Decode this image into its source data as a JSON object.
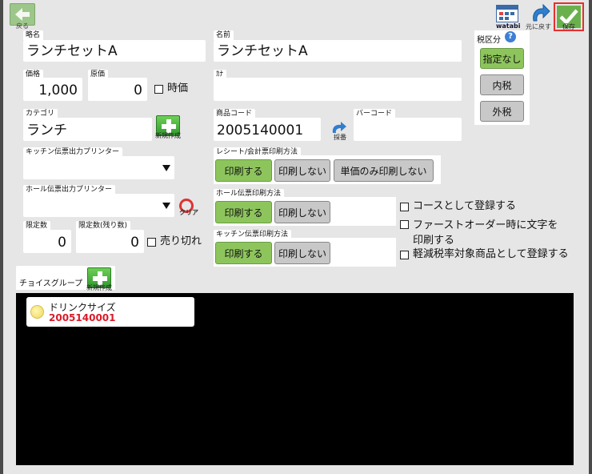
{
  "toolbar": {
    "back_label": "戻る",
    "watabi_label": "watabi",
    "revert_label": "元に戻す",
    "save_label": "保存"
  },
  "fields": {
    "short_name": {
      "label": "略名",
      "value": "ランチセットA"
    },
    "name": {
      "label": "名前",
      "value": "ランチセットA"
    },
    "price": {
      "label": "価格",
      "value": "1,000"
    },
    "cost": {
      "label": "原価",
      "value": "0"
    },
    "market_price": {
      "label": "時価"
    },
    "kana": {
      "label": "ｶﾅ",
      "value": ""
    },
    "category": {
      "label": "カテゴリ",
      "value": "ランチ",
      "new_button": "新規作成"
    },
    "product_code": {
      "label": "商品コード",
      "value": "2005140001",
      "numbering_button": "採番"
    },
    "barcode": {
      "label": "バーコード",
      "value": ""
    },
    "kitchen_printer": {
      "label": "キッチン伝票出力プリンター",
      "value": ""
    },
    "hall_printer": {
      "label": "ホール伝票出力プリンター",
      "value": "",
      "clear_button": "クリア"
    },
    "limit": {
      "label": "限定数",
      "value": "0"
    },
    "limit_remaining": {
      "label": "限定数(残り数)",
      "value": "0"
    },
    "sold_out": {
      "label": "売り切れ"
    }
  },
  "tax": {
    "label": "税区分",
    "options": [
      "指定なし",
      "内税",
      "外税"
    ],
    "selected": "指定なし"
  },
  "receipt_print": {
    "label": "レシート/会計票印刷方法",
    "options": [
      "印刷する",
      "印刷しない",
      "単価のみ印刷しない"
    ],
    "selected": "印刷する"
  },
  "hall_print": {
    "label": "ホール伝票印刷方法",
    "options": [
      "印刷する",
      "印刷しない"
    ],
    "selected": "印刷する"
  },
  "kitchen_print": {
    "label": "キッチン伝票印刷方法",
    "options": [
      "印刷する",
      "印刷しない"
    ],
    "selected": "印刷する"
  },
  "checkboxes": {
    "course": "コースとして登録する",
    "first_order_line1": "ファーストオーダー時に文字を",
    "first_order_line2": "印刷する",
    "reduced_tax": "軽減税率対象商品として登録する"
  },
  "choice_group": {
    "label": "チョイスグループ",
    "new_button": "新規作成",
    "items": [
      {
        "name": "ドリンクサイズ",
        "code": "2005140001"
      }
    ]
  },
  "colors": {
    "selected_green": "#8dc55c",
    "code_red": "#d81b2a",
    "save_border": "#e53030"
  }
}
